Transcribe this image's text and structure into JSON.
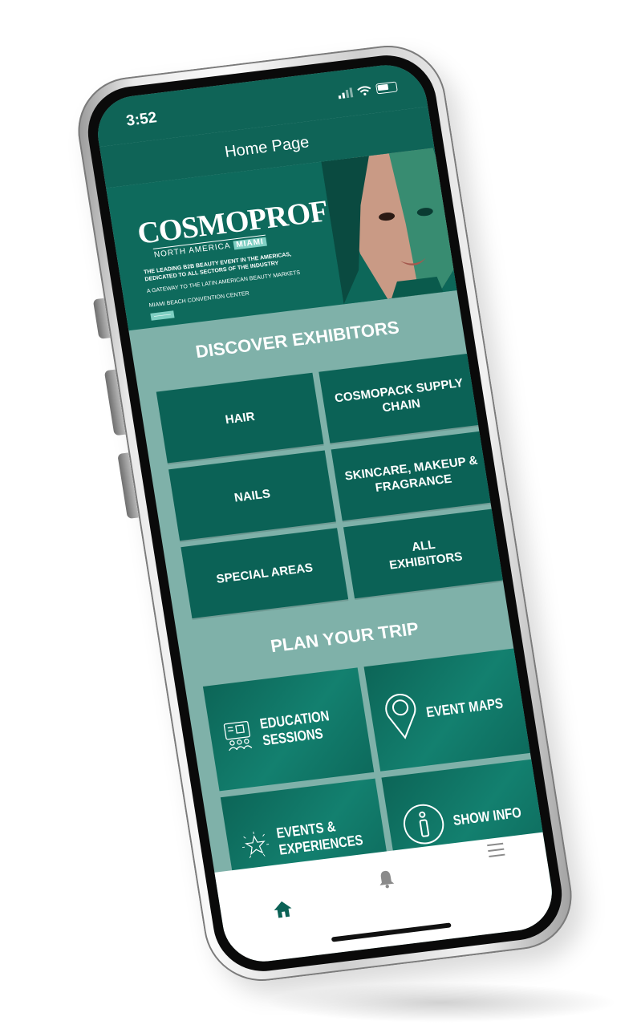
{
  "status_bar": {
    "time": "3:52"
  },
  "header": {
    "title": "Home Page"
  },
  "banner": {
    "logo": "COSMOPROF",
    "logo_sub": "NORTH AMERICA",
    "logo_city": "MIAMI",
    "line1": "THE LEADING B2B BEAUTY EVENT IN THE AMERICAS, DEDICATED TO ALL SECTORS OF THE INDUSTRY",
    "line2": "A GATEWAY TO THE LATIN AMERICAN BEAUTY MARKETS",
    "line3": "MIAMI BEACH CONVENTION CENTER"
  },
  "discover": {
    "title": "DISCOVER EXHIBITORS",
    "tiles": [
      "HAIR",
      "COSMOPACK SUPPLY CHAIN",
      "NAILS",
      "SKINCARE, MAKEUP & FRAGRANCE",
      "SPECIAL AREAS",
      "ALL EXHIBITORS"
    ]
  },
  "plan": {
    "title": "PLAN YOUR TRIP",
    "tiles": [
      {
        "label": "EDUCATION SESSIONS",
        "icon": "presentation-icon"
      },
      {
        "label": "EVENT MAPS",
        "icon": "map-pin-icon"
      },
      {
        "label": "EVENTS & EXPERIENCES",
        "icon": "star-icon"
      },
      {
        "label": "SHOW INFO",
        "icon": "info-icon"
      }
    ]
  },
  "tabbar": {
    "items": [
      "home-icon",
      "bell-icon",
      "menu-icon"
    ]
  },
  "colors": {
    "primary": "#0b6256",
    "background": "#7fb1a9",
    "accent": "#7fcfc3"
  }
}
